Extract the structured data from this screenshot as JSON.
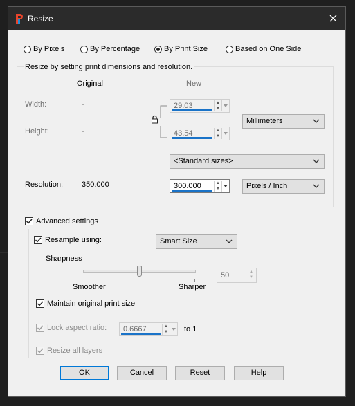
{
  "window": {
    "title": "Resize",
    "close_label": "×"
  },
  "mode_radios": [
    {
      "label": "By Pixels",
      "selected": false
    },
    {
      "label": "By Percentage",
      "selected": false
    },
    {
      "label": "By Print Size",
      "selected": true
    },
    {
      "label": "Based on One Side",
      "selected": false
    }
  ],
  "print_group": {
    "caption": "Resize by setting print dimensions and resolution.",
    "col_original": "Original",
    "col_new": "New",
    "width_label": "Width:",
    "width_original": "-",
    "width_new": "29.03",
    "height_label": "Height:",
    "height_original": "-",
    "height_new": "43.54",
    "units": "Millimeters",
    "standard_sizes": "<Standard sizes>",
    "resolution_label": "Resolution:",
    "resolution_original": "350.000",
    "resolution_new": "300.000",
    "resolution_units": "Pixels / Inch"
  },
  "advanced": {
    "advanced_label": "Advanced settings",
    "advanced_checked": true,
    "resample_label": "Resample using:",
    "resample_checked": true,
    "resample_method": "Smart Size",
    "sharpness_label": "Sharpness",
    "sharpness_value": "50",
    "sharpness_level": 0.5,
    "smoother_label": "Smoother",
    "sharper_label": "Sharper",
    "maintain_label": "Maintain original print size",
    "maintain_checked": true,
    "lock_label": "Lock aspect ratio:",
    "lock_checked": true,
    "ratio_value": "0.6667",
    "ratio_suffix": "to 1",
    "layers_label": "Resize all layers",
    "layers_checked": true
  },
  "buttons": {
    "ok": "OK",
    "cancel": "Cancel",
    "reset": "Reset",
    "help": "Help"
  },
  "colors": {
    "accent": "#1a73c8",
    "titlebar": "#2b2b2b",
    "dialog_bg": "#f0f0f0"
  }
}
